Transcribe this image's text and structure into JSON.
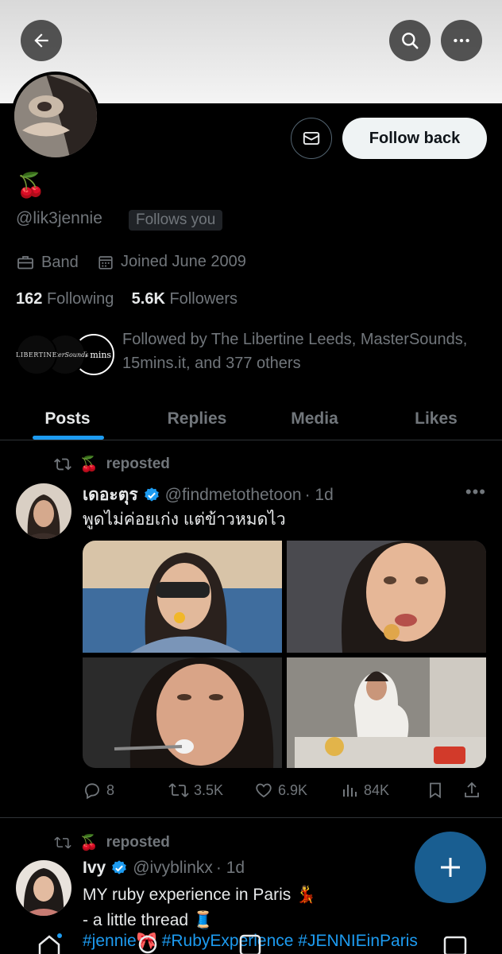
{
  "header": {
    "back_icon": "arrow-left-icon",
    "search_icon": "search-icon",
    "more_icon": "more-horizontal-icon"
  },
  "profile": {
    "display_name_emoji": "🍒",
    "handle": "@lik3jennie",
    "follows_you": "Follows you",
    "follow_back": "Follow back",
    "category": "Band",
    "joined": "Joined June 2009",
    "following_count": "162",
    "following_label": "Following",
    "followers_count": "5.6K",
    "followers_label": "Followers",
    "followed_by": "Followed by The Libertine Leeds, MasterSounds, 15mins.it, and 377 others",
    "followed_by_avatars": [
      "LIBERTINE",
      "MasterSounds",
      "15 mins"
    ]
  },
  "tabs": [
    "Posts",
    "Replies",
    "Media",
    "Likes"
  ],
  "active_tab": "Posts",
  "posts": [
    {
      "repost_emoji": "🍒",
      "repost_label": "reposted",
      "name": "เดอะตุร",
      "handle": "@findmetothetoon",
      "time": "· 1d",
      "text": "พูดไม่ค่อยเก่ง แต่ข้าวหมดไว",
      "replies": "8",
      "reposts": "3.5K",
      "likes": "6.9K",
      "views": "84K"
    },
    {
      "repost_emoji": "🍒",
      "repost_label": "reposted",
      "name": "Ivy",
      "handle": "@ivyblinkx",
      "time": "· 1d",
      "text1": "MY ruby experience in Paris 💃",
      "text2": "- a little thread 🧵",
      "hashtags": "#jennie🎀 #RubyExperience #JENNIEinParis"
    }
  ],
  "colors": {
    "accent": "#1d9bf0",
    "secondary_text": "#71767b",
    "background": "#000000"
  }
}
